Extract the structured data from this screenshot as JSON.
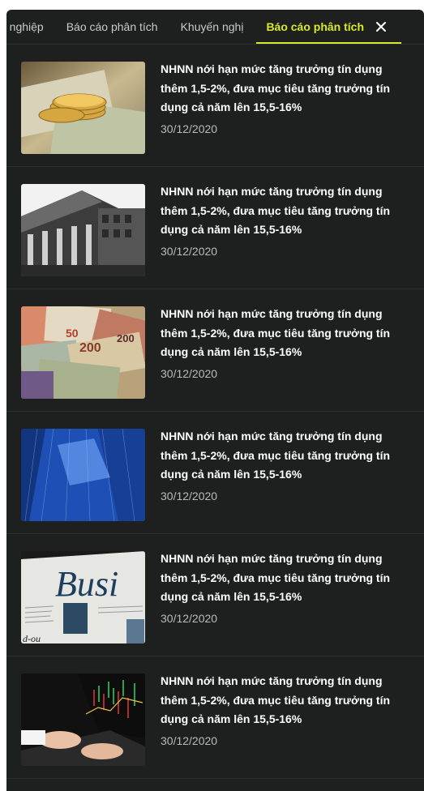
{
  "tabs": [
    {
      "label": "n nghiệp"
    },
    {
      "label": "Báo cáo phân tích"
    },
    {
      "label": "Khuyến nghị"
    },
    {
      "label": "Báo cáo phân tích",
      "active": true
    }
  ],
  "close_icon": "close-icon",
  "accent_color": "#d9ea2a",
  "articles": [
    {
      "image": "gold-coins-on-dollar-bills",
      "title": "NHNN nới hạn mức tăng trưởng tín dụng thêm 1,5-2%, đưa mục tiêu tăng trưởng tín dụng cả năm lên 15,5-16%",
      "date": "30/12/2020"
    },
    {
      "image": "bank-building-columns",
      "title": "NHNN nới hạn mức tăng trưởng tín dụng thêm 1,5-2%, đưa mục tiêu tăng trưởng tín dụng cả năm lên 15,5-16%",
      "date": "30/12/2020"
    },
    {
      "image": "world-currency-banknotes",
      "title": "NHNN nới hạn mức tăng trưởng tín dụng thêm 1,5-2%, đưa mục tiêu tăng trưởng tín dụng cả năm lên 15,5-16%",
      "date": "30/12/2020"
    },
    {
      "image": "blue-skyscrapers",
      "title": "NHNN nới hạn mức tăng trưởng tín dụng thêm 1,5-2%, đưa mục tiêu tăng trưởng tín dụng cả năm lên 15,5-16%",
      "date": "30/12/2020"
    },
    {
      "image": "business-newspaper",
      "image_text": "Busi",
      "title": "NHNN nới hạn mức tăng trưởng tín dụng thêm 1,5-2%, đưa mục tiêu tăng trưởng tín dụng cả năm lên 15,5-16%",
      "date": "30/12/2020"
    },
    {
      "image": "trading-laptop-hands",
      "title": "NHNN nới hạn mức tăng trưởng tín dụng thêm 1,5-2%, đưa mục tiêu tăng trưởng tín dụng cả năm lên 15,5-16%",
      "date": "30/12/2020"
    }
  ]
}
